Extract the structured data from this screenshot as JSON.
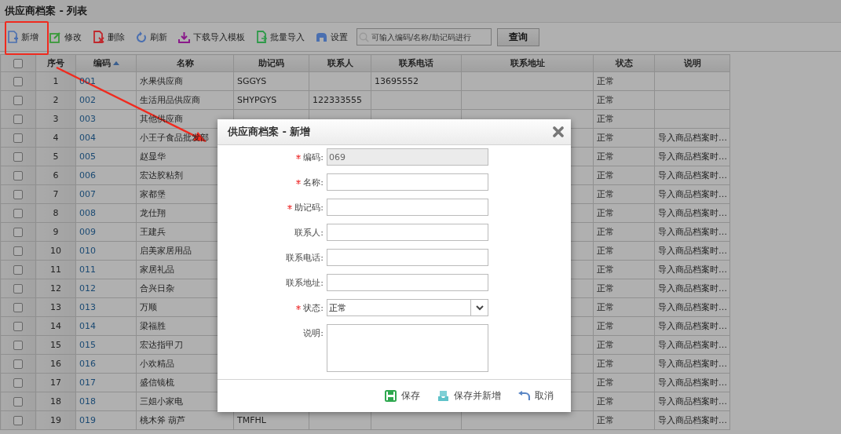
{
  "window": {
    "title": "供应商档案 - 列表"
  },
  "toolbar": {
    "buttons": [
      {
        "kind": "add",
        "label": "新增"
      },
      {
        "kind": "edit",
        "label": "修改"
      },
      {
        "kind": "delete",
        "label": "删除"
      },
      {
        "kind": "refresh",
        "label": "刷新"
      },
      {
        "kind": "download",
        "label": "下载导入模板"
      },
      {
        "kind": "import",
        "label": "批量导入"
      },
      {
        "kind": "settings",
        "label": "设置"
      }
    ],
    "search": {
      "placeholder": "可输入编码/名称/助记码进行"
    },
    "query_button": "查询"
  },
  "table": {
    "select_all": {
      "checked": false
    },
    "columns": [
      {
        "label": "序号",
        "sorted": false
      },
      {
        "label": "编码",
        "sorted": true
      },
      {
        "label": "名称",
        "sorted": false
      },
      {
        "label": "助记码",
        "sorted": false
      },
      {
        "label": "联系人",
        "sorted": false
      },
      {
        "label": "联系电话",
        "sorted": false
      },
      {
        "label": "联系地址",
        "sorted": false
      },
      {
        "label": "状态",
        "sorted": false
      },
      {
        "label": "说明",
        "sorted": false
      }
    ],
    "rows": [
      {
        "checked": false,
        "cells": [
          "1",
          "001",
          "水果供应商",
          "SGGYS",
          "",
          "13695552",
          "",
          "正常",
          ""
        ]
      },
      {
        "checked": false,
        "cells": [
          "2",
          "002",
          "生活用品供应商",
          "SHYPGYS",
          "122333555",
          "",
          "",
          "正常",
          ""
        ]
      },
      {
        "checked": false,
        "cells": [
          "3",
          "003",
          "其他供应商",
          "",
          "",
          "",
          "",
          "正常",
          ""
        ]
      },
      {
        "checked": false,
        "cells": [
          "4",
          "004",
          "小王子食品批发部",
          "",
          "",
          "",
          "",
          "正常",
          "导入商品档案时…"
        ]
      },
      {
        "checked": false,
        "cells": [
          "5",
          "005",
          "赵显华",
          "",
          "",
          "",
          "",
          "正常",
          "导入商品档案时…"
        ]
      },
      {
        "checked": false,
        "cells": [
          "6",
          "006",
          "宏达胶粘剂",
          "",
          "",
          "",
          "",
          "正常",
          "导入商品档案时…"
        ]
      },
      {
        "checked": false,
        "cells": [
          "7",
          "007",
          "家都堡",
          "",
          "",
          "",
          "",
          "正常",
          "导入商品档案时…"
        ]
      },
      {
        "checked": false,
        "cells": [
          "8",
          "008",
          "龙仕翔",
          "",
          "",
          "",
          "",
          "正常",
          "导入商品档案时…"
        ]
      },
      {
        "checked": false,
        "cells": [
          "9",
          "009",
          "王建兵",
          "",
          "",
          "",
          "",
          "正常",
          "导入商品档案时…"
        ]
      },
      {
        "checked": false,
        "cells": [
          "10",
          "010",
          "启美家居用品",
          "",
          "",
          "",
          "",
          "正常",
          "导入商品档案时…"
        ]
      },
      {
        "checked": false,
        "cells": [
          "11",
          "011",
          "家居礼品",
          "",
          "",
          "",
          "",
          "正常",
          "导入商品档案时…"
        ]
      },
      {
        "checked": false,
        "cells": [
          "12",
          "012",
          "合兴日杂",
          "",
          "",
          "",
          "",
          "正常",
          "导入商品档案时…"
        ]
      },
      {
        "checked": false,
        "cells": [
          "13",
          "013",
          "万顺",
          "",
          "",
          "",
          "",
          "正常",
          "导入商品档案时…"
        ]
      },
      {
        "checked": false,
        "cells": [
          "14",
          "014",
          "梁福胜",
          "",
          "",
          "",
          "",
          "正常",
          "导入商品档案时…"
        ]
      },
      {
        "checked": false,
        "cells": [
          "15",
          "015",
          "宏达指甲刀",
          "",
          "",
          "",
          "",
          "正常",
          "导入商品档案时…"
        ]
      },
      {
        "checked": false,
        "cells": [
          "16",
          "016",
          "小欢精品",
          "",
          "",
          "",
          "",
          "正常",
          "导入商品档案时…"
        ]
      },
      {
        "checked": false,
        "cells": [
          "17",
          "017",
          "盛信镜梳",
          "",
          "",
          "",
          "",
          "正常",
          "导入商品档案时…"
        ]
      },
      {
        "checked": false,
        "cells": [
          "18",
          "018",
          "三姐小家电",
          "",
          "",
          "",
          "",
          "正常",
          "导入商品档案时…"
        ]
      },
      {
        "checked": false,
        "cells": [
          "19",
          "019",
          "桃木斧 葫芦",
          "TMFHL",
          "",
          "",
          "",
          "正常",
          "导入商品档案时…"
        ]
      }
    ]
  },
  "dialog": {
    "title": "供应商档案 - 新增",
    "fields": [
      {
        "kind": "text",
        "label": "编码:",
        "required": true,
        "disabled": true,
        "value": "069"
      },
      {
        "kind": "text",
        "label": "名称:",
        "required": true,
        "disabled": false
      },
      {
        "kind": "text",
        "label": "助记码:",
        "required": true,
        "disabled": false
      },
      {
        "kind": "text",
        "label": "联系人:",
        "required": false,
        "disabled": false
      },
      {
        "kind": "text",
        "label": "联系电话:",
        "required": false,
        "disabled": false
      },
      {
        "kind": "text",
        "label": "联系地址:",
        "required": false,
        "disabled": false
      },
      {
        "kind": "select",
        "label": "状态:",
        "required": true,
        "disabled": false,
        "value": "正常"
      },
      {
        "kind": "textarea",
        "label": "说明:",
        "required": false,
        "disabled": false
      }
    ],
    "buttons": [
      {
        "kind": "save",
        "label": "保存"
      },
      {
        "kind": "save-new",
        "label": "保存并新增"
      },
      {
        "kind": "cancel",
        "label": "取消"
      }
    ]
  }
}
